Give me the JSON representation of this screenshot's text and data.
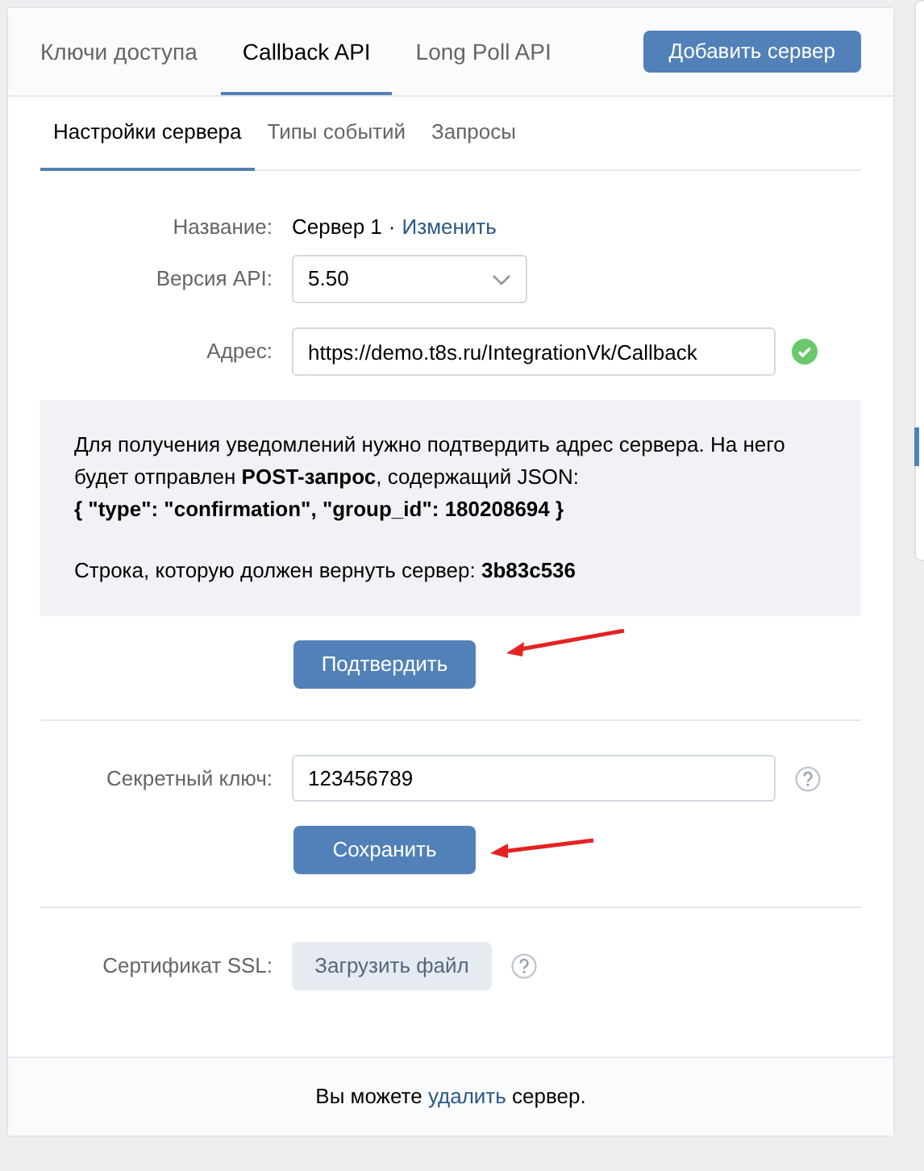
{
  "tabs": [
    {
      "label": "Ключи доступа",
      "selected": false
    },
    {
      "label": "Callback API",
      "selected": true
    },
    {
      "label": "Long Poll API",
      "selected": false
    }
  ],
  "add_server_button": "Добавить сервер",
  "subtabs": [
    {
      "label": "Настройки сервера",
      "selected": true
    },
    {
      "label": "Типы событий",
      "selected": false
    },
    {
      "label": "Запросы",
      "selected": false
    }
  ],
  "name_row": {
    "label": "Название:",
    "value": "Сервер 1",
    "separator": "·",
    "edit_link": "Изменить"
  },
  "api_version": {
    "label": "Версия API:",
    "value": "5.50"
  },
  "address": {
    "label": "Адрес:",
    "value": "https://demo.t8s.ru/IntegrationVk/Callback",
    "verified": true
  },
  "confirmation": {
    "paragraphs": [
      "Для получения уведомлений нужно подтвердить адрес сервера. На него будет отправлен **POST-запрос**, содержащий JSON:",
      "**{ \"type\": \"confirmation\", \"group_id\": 180208694 }**",
      "Строка, которую должен вернуть сервер: **3b83c536**"
    ],
    "button": "Подтвердить"
  },
  "secret_key": {
    "label": "Секретный ключ:",
    "value": "123456789",
    "button": "Сохранить"
  },
  "ssl": {
    "label": "Сертификат SSL:",
    "button": "Загрузить файл"
  },
  "footer": {
    "before": "Вы можете ",
    "link": "удалить",
    "after": " сервер."
  }
}
